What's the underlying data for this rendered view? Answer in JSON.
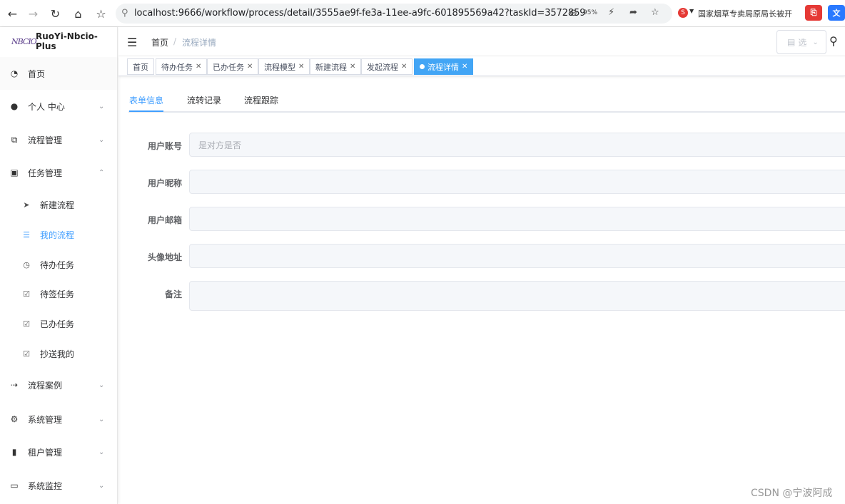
{
  "browser": {
    "url": "localhost:9666/workflow/process/detail/3555ae9f-fe3a-11ee-a9fc-601895569a42?taskId=3572859",
    "zoom": "95%",
    "tab_hint": "国家烟草专卖局原局长被开"
  },
  "sidebar": {
    "logo_mark": "NBCIO",
    "app_name": "RuoYi-Nbcio-Plus",
    "home": "首页",
    "menus": [
      {
        "label": "个人 中心",
        "icon": "user-icon"
      },
      {
        "label": "流程管理",
        "icon": "flow-icon"
      },
      {
        "label": "任务管理",
        "icon": "task-icon"
      }
    ],
    "task_children": [
      {
        "label": "新建流程",
        "icon": "send-icon"
      },
      {
        "label": "我的流程",
        "icon": "list-icon"
      },
      {
        "label": "待办任务",
        "icon": "clock-icon"
      },
      {
        "label": "待签任务",
        "icon": "check-icon"
      },
      {
        "label": "已办任务",
        "icon": "check-icon"
      },
      {
        "label": "抄送我的",
        "icon": "check-icon"
      }
    ],
    "menus_after": [
      {
        "label": "流程案例",
        "icon": "case-icon"
      },
      {
        "label": "系统管理",
        "icon": "gear-icon"
      },
      {
        "label": "租户管理",
        "icon": "bar-chart-icon"
      },
      {
        "label": "系统监控",
        "icon": "monitor-icon"
      }
    ]
  },
  "navbar": {
    "breadcrumb_home": "首页",
    "breadcrumb_separator": "/",
    "breadcrumb_current": "流程详情",
    "select_placeholder": "选"
  },
  "tags": [
    {
      "label": "首页",
      "closable": false
    },
    {
      "label": "待办任务",
      "closable": true
    },
    {
      "label": "已办任务",
      "closable": true
    },
    {
      "label": "流程模型",
      "closable": true
    },
    {
      "label": "新建流程",
      "closable": true
    },
    {
      "label": "发起流程",
      "closable": true
    },
    {
      "label": "流程详情",
      "closable": true,
      "active": true
    }
  ],
  "tabs": [
    "表单信息",
    "流转记录",
    "流程跟踪"
  ],
  "form": [
    {
      "label": "用户账号",
      "value": "是对方是否"
    },
    {
      "label": "用户昵称",
      "value": ""
    },
    {
      "label": "用户邮箱",
      "value": ""
    },
    {
      "label": "头像地址",
      "value": ""
    },
    {
      "label": "备注",
      "value": ""
    }
  ],
  "watermark": "CSDN @宁波阿成",
  "colors": {
    "accent": "#409eff",
    "active_tag": "#42a5f5"
  }
}
